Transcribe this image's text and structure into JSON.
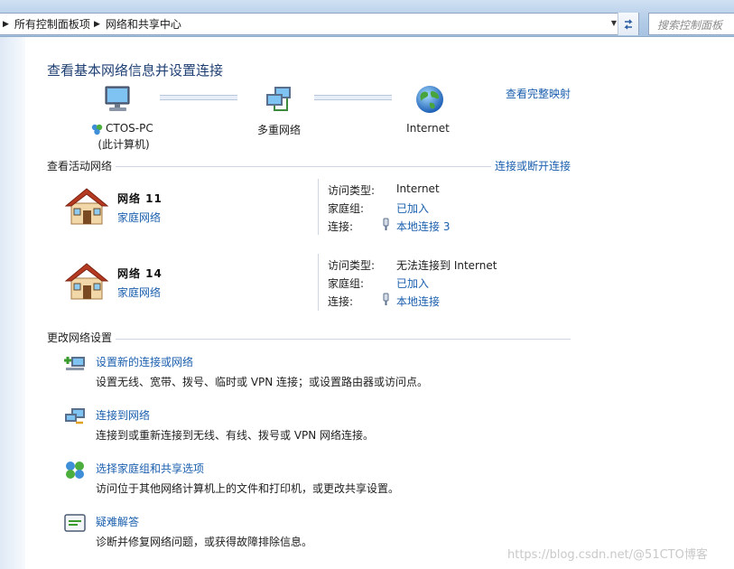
{
  "address_bar": {
    "crumbs": [
      "所有控制面板项",
      "网络和共享中心"
    ],
    "search_placeholder": "搜索控制面板"
  },
  "heading": "查看基本网络信息并设置连接",
  "view_full_map": "查看完整映射",
  "map": {
    "computer_name": "CTOS-PC",
    "computer_sub": "(此计算机)",
    "middle": "多重网络",
    "internet": "Internet"
  },
  "active_networks": {
    "title": "查看活动网络",
    "connect_link": "连接或断开连接",
    "labels": {
      "access_type": "访问类型:",
      "homegroup": "家庭组:",
      "connections": "连接:"
    },
    "networks": [
      {
        "name": "网络  11",
        "type": "家庭网络",
        "access": "Internet",
        "homegroup": "已加入",
        "connection": "本地连接 3"
      },
      {
        "name": "网络  14",
        "type": "家庭网络",
        "access": "无法连接到 Internet",
        "homegroup": "已加入",
        "connection": "本地连接"
      }
    ]
  },
  "change_settings": {
    "title": "更改网络设置",
    "tasks": [
      {
        "title": "设置新的连接或网络",
        "desc": "设置无线、宽带、拨号、临时或 VPN 连接；或设置路由器或访问点。",
        "icon": "new-connection-icon"
      },
      {
        "title": "连接到网络",
        "desc": "连接到或重新连接到无线、有线、拨号或 VPN 网络连接。",
        "icon": "connect-network-icon"
      },
      {
        "title": "选择家庭组和共享选项",
        "desc": "访问位于其他网络计算机上的文件和打印机，或更改共享设置。",
        "icon": "homegroup-icon"
      },
      {
        "title": "疑难解答",
        "desc": "诊断并修复网络问题，或获得故障排除信息。",
        "icon": "troubleshoot-icon"
      }
    ]
  },
  "watermark": "https://blog.csdn.net/@51CTO博客"
}
